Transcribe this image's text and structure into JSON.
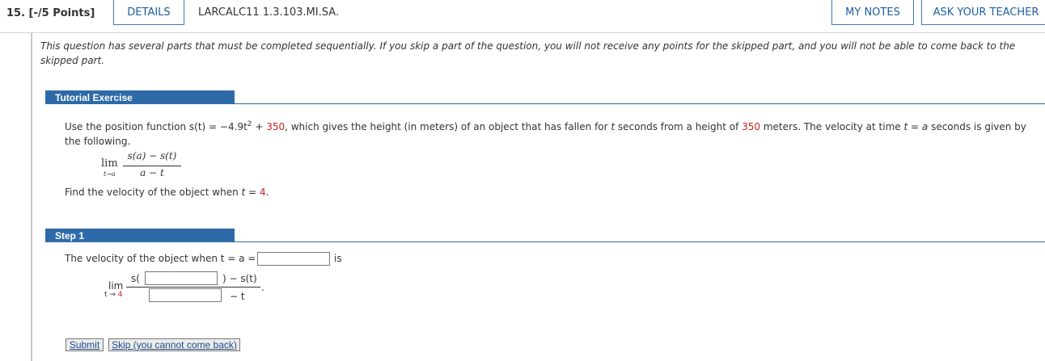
{
  "header": {
    "question_number": "15. [-/5 Points]",
    "details_label": "DETAILS",
    "problem_code": "LARCALC11 1.3.103.MI.SA.",
    "my_notes_label": "MY NOTES",
    "ask_teacher_label": "ASK YOUR TEACHER"
  },
  "notice": "This question has several parts that must be completed sequentially. If you skip a part of the question, you will not receive any points for the skipped part, and you will not be able to come back to the skipped part.",
  "tutorial": {
    "title": "Tutorial Exercise",
    "text_1": "Use the position function s(t) = −4.9t",
    "text_sup": "2",
    "text_2": " + ",
    "value_350a": "350",
    "text_3": ", which gives the height (in meters) of an object that has fallen for ",
    "text_t": "t",
    "text_4": " seconds from a height of ",
    "value_350b": "350",
    "text_5": " meters. The velocity at time ",
    "text_t2": "t",
    "text_6": " = ",
    "text_a": "a",
    "text_7": " seconds is given by the following.",
    "lim_word": "lim",
    "lim_sub": "t→a",
    "numerator": "s(a) − s(t)",
    "denominator": "a − t",
    "find_1": "Find the velocity of the object when ",
    "find_t": "t",
    "find_2": " = ",
    "find_val": "4",
    "find_3": "."
  },
  "step1": {
    "title": "Step 1",
    "prompt": "The velocity of the object when t = a =",
    "is_label": "is",
    "s_open": "s(",
    "num_tail": ") − s(t)",
    "den_tail": "− t",
    "lim_word": "lim",
    "lim_sub_t": "t → ",
    "lim_sub_val": "4",
    "period": "."
  },
  "buttons": {
    "submit": "Submit",
    "skip": "Skip (you cannot come back)"
  },
  "colors": {
    "accent_blue": "#2e6aa8",
    "highlight_red": "#c8201f"
  }
}
